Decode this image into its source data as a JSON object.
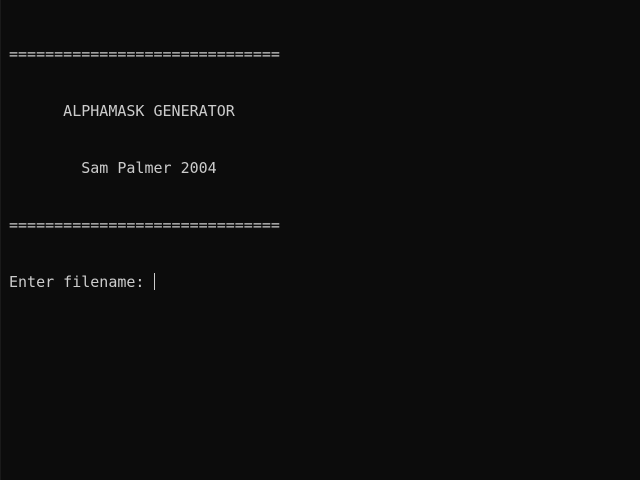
{
  "console": {
    "lines": [
      "==============================",
      "      ALPHAMASK GENERATOR",
      "        Sam Palmer 2004",
      "=============================="
    ],
    "prompt": "Enter filename: ",
    "input_value": ""
  }
}
